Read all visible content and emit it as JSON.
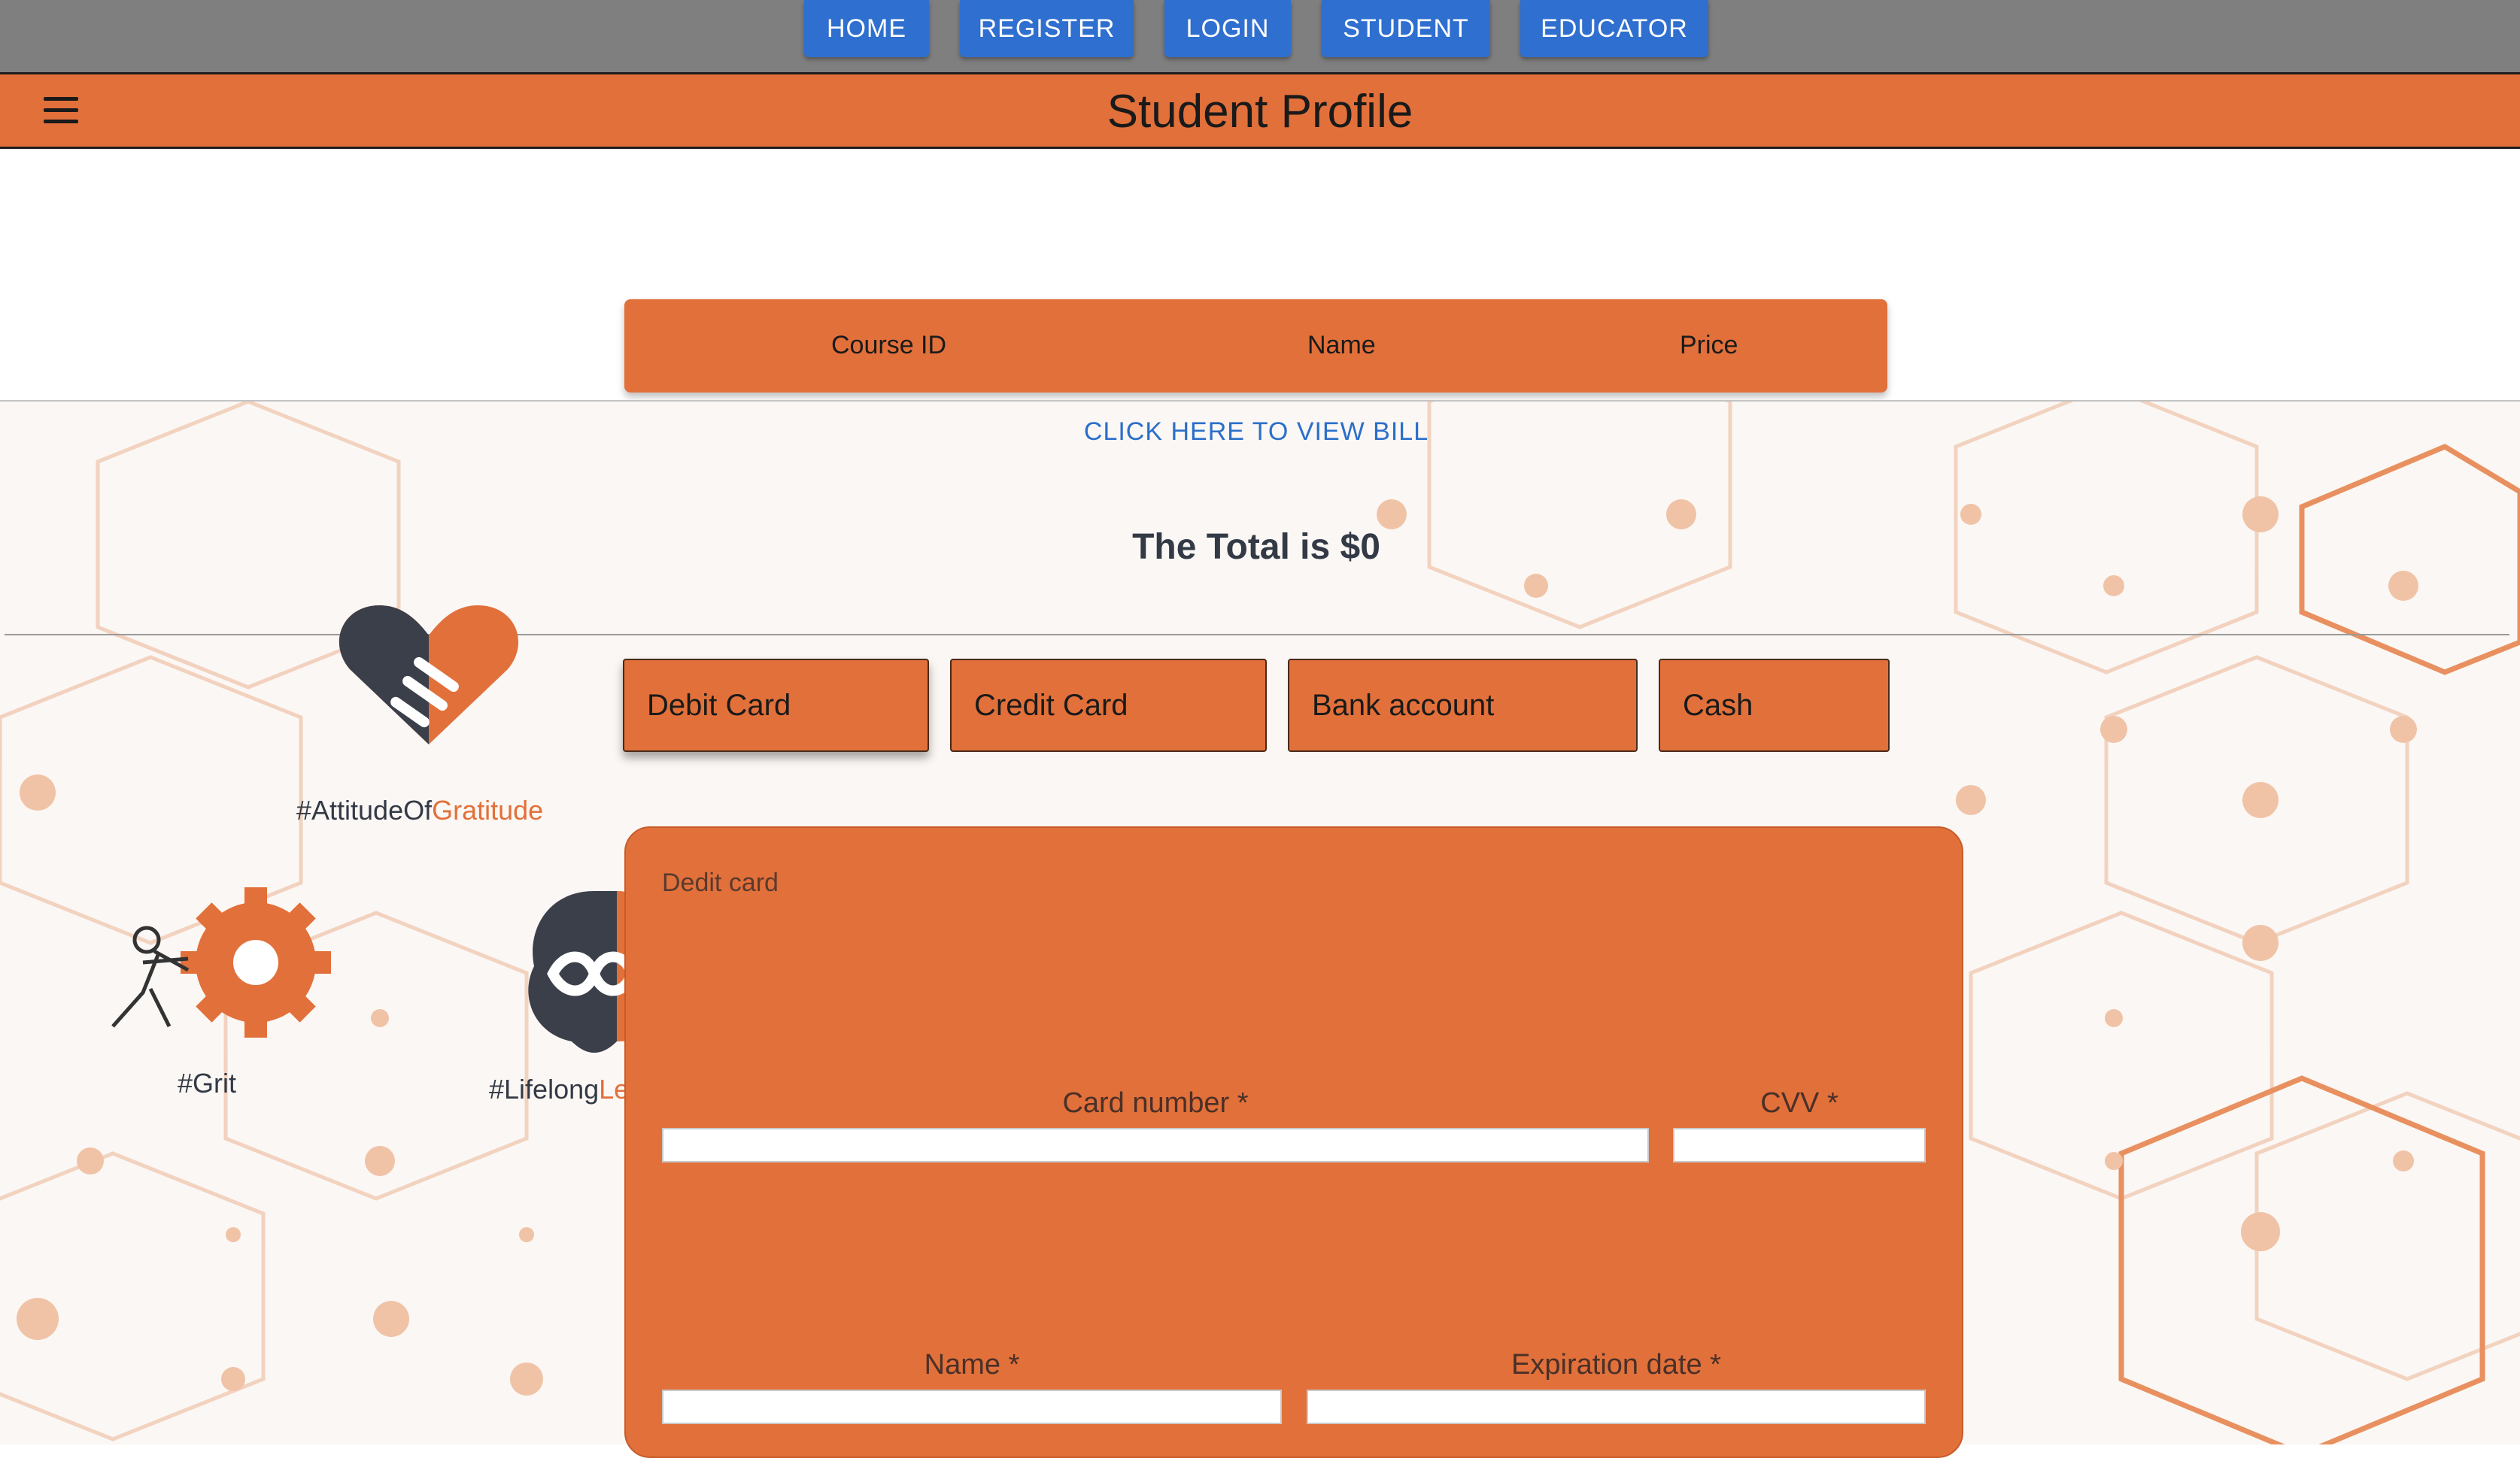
{
  "nav": {
    "buttons": [
      "HOME",
      "REGISTER",
      "LOGIN",
      "STUDENT",
      "EDUCATOR"
    ]
  },
  "header": {
    "title": "Student Profile",
    "menu_icon": "hamburger-menu-icon"
  },
  "course_table": {
    "columns": [
      "Course ID",
      "Name",
      "Price"
    ]
  },
  "bill": {
    "view_bill_label": "CLICK HERE TO VIEW BILL",
    "total_text": "The Total is $0"
  },
  "payment": {
    "tabs": [
      "Debit Card",
      "Credit Card",
      "Bank account",
      "Cash"
    ],
    "active_tab": "Debit Card",
    "panel_label": "Dedit card",
    "fields": {
      "card_number": {
        "label": "Card number *",
        "value": ""
      },
      "cvv": {
        "label": "CVV *",
        "value": ""
      },
      "name": {
        "label": "Name *",
        "value": ""
      },
      "expiration": {
        "label": "Expiration date *",
        "value": ""
      }
    }
  },
  "logos": {
    "gratitude_prefix": "#AttitudeOf",
    "gratitude_accent": "Gratitude",
    "grit": "#Grit",
    "lifelong_prefix": "#Lifelong",
    "lifelong_accent": "Le"
  },
  "colors": {
    "accent": "#e2703a",
    "nav_button": "#2f6fcf",
    "link": "#2a6fc9",
    "dark": "#333a46"
  }
}
